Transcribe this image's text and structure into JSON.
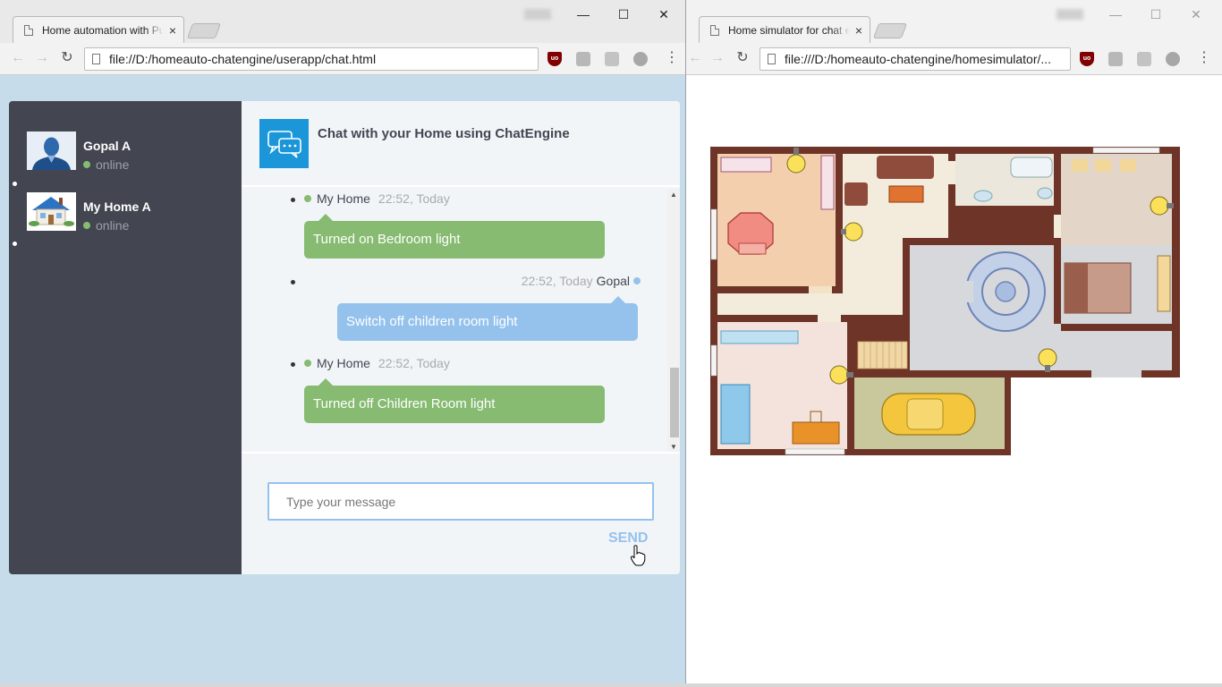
{
  "left_window": {
    "tab_title": "Home automation with PubNub",
    "tab_close": "×",
    "address": "file://D:/homeauto-chatengine/userapp/chat.html",
    "window_controls": [
      "—",
      "☐",
      "✕"
    ]
  },
  "right_window": {
    "tab_title": "Home simulator for chat engine",
    "tab_close": "×",
    "address": "file:///D:/homeauto-chatengine/homesimulator/...",
    "window_controls": [
      "—",
      "☐",
      "✕"
    ]
  },
  "toolbar": {
    "back_icon": "←",
    "forward_icon": "→",
    "reload_icon": "↻",
    "ext_ublock": "uo",
    "menu_icon": "⋮"
  },
  "people": [
    {
      "name": "Gopal A",
      "status": "online",
      "avatar": "person-avatar"
    },
    {
      "name": "My Home A",
      "status": "online",
      "avatar": "house-avatar"
    }
  ],
  "chat": {
    "title": "Chat with your Home using ChatEngine",
    "messages": [
      {
        "sender": "My Home",
        "time": "22:52, Today",
        "text": "Turned on Bedroom light",
        "side": "left"
      },
      {
        "sender": "Gopal",
        "time": "22:52, Today",
        "text": "Switch off children room light",
        "side": "right"
      },
      {
        "sender": "My Home",
        "time": "22:52, Today",
        "text": "Turned off Children Room light",
        "side": "left"
      }
    ],
    "input_placeholder": "Type your message",
    "send_label": "SEND"
  },
  "colors": {
    "sidebar": "#434651",
    "online_green": "#86bb71",
    "user_blue": "#94c2ed",
    "page_bg": "#c7dcea"
  }
}
